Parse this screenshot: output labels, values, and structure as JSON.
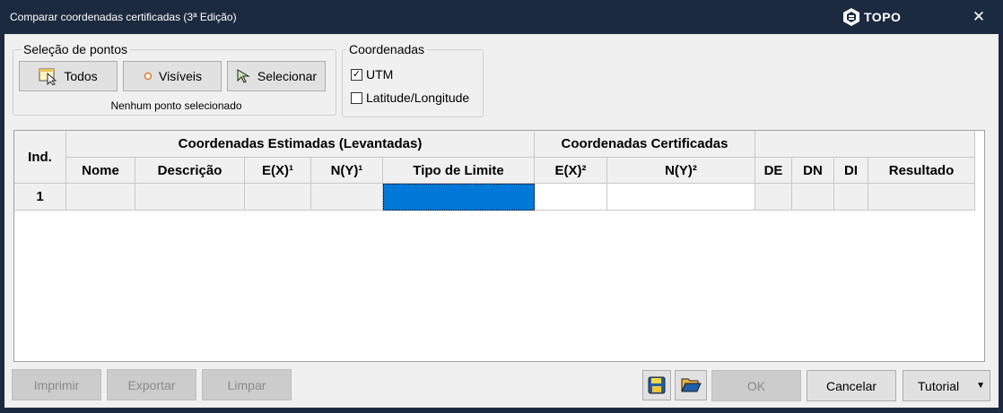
{
  "window": {
    "title": "Comparar coordenadas certificadas (3ª Edição)",
    "logo_text": "TOPO",
    "close_glyph": "✕"
  },
  "selection_group": {
    "legend": "Seleção de pontos",
    "buttons": [
      {
        "label": "Todos",
        "icon": "select-all-icon"
      },
      {
        "label": "Visíveis",
        "icon": "visible-points-icon"
      },
      {
        "label": "Selecionar",
        "icon": "cursor-select-icon"
      }
    ],
    "status": "Nenhum ponto selecionado"
  },
  "coords_group": {
    "legend": "Coordenadas",
    "options": [
      {
        "label": "UTM",
        "checked": true
      },
      {
        "label": "Latitude/Longitude",
        "checked": false
      }
    ],
    "check_glyph": "✓"
  },
  "grid": {
    "header_groups": {
      "index": "Ind.",
      "estimated": "Coordenadas Estimadas (Levantadas)",
      "certified": "Coordenadas Certificadas"
    },
    "columns": [
      "Nome",
      "Descrição",
      "E(X)¹",
      "N(Y)¹",
      "Tipo de Limite",
      "E(X)²",
      "N(Y)²",
      "DE",
      "DN",
      "DI",
      "Resultado"
    ],
    "rows": [
      {
        "index": "1",
        "cells": [
          "",
          "",
          "",
          "",
          "",
          "",
          "",
          "",
          "",
          "",
          ""
        ]
      }
    ]
  },
  "footer": {
    "print": "Imprimir",
    "export": "Exportar",
    "clear": "Limpar",
    "ok": "OK",
    "cancel": "Cancelar",
    "tutorial": "Tutorial",
    "tutorial_arrow": "▼",
    "save_icon": "save-icon",
    "open_icon": "folder-open-icon"
  },
  "colors": {
    "titlebar": "#1b2a3f",
    "selection": "#0078d7",
    "client_bg": "#f0f0f0"
  }
}
